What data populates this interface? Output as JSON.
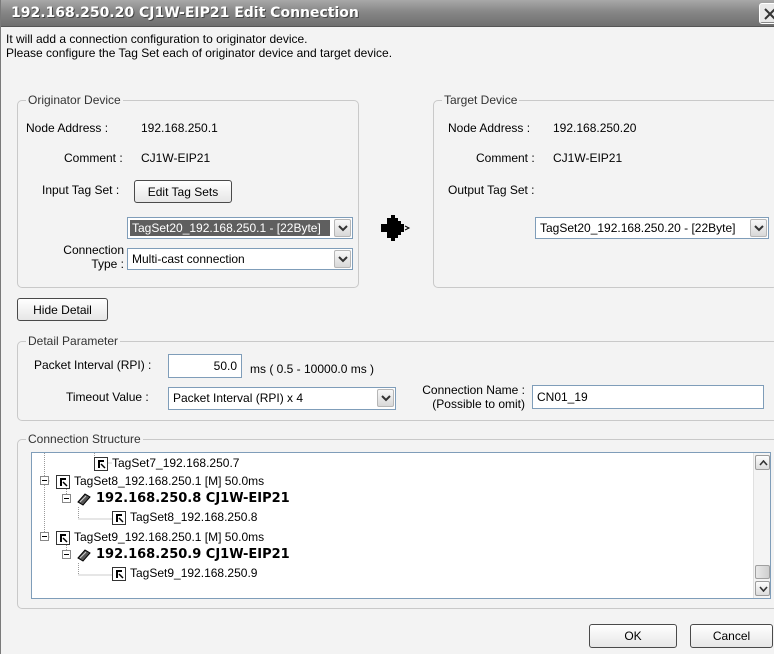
{
  "window": {
    "title": "192.168.250.20 CJ1W-EIP21 Edit Connection",
    "close_icon": "close-icon"
  },
  "intro": {
    "line1": "It will add a connection configuration to originator device.",
    "line2": "Please configure the Tag Set each of originator device and target device."
  },
  "originator": {
    "legend": "Originator Device",
    "node_address_label": "Node Address :",
    "node_address": "192.168.250.1",
    "comment_label": "Comment :",
    "comment": "CJ1W-EIP21",
    "input_tag_set_label": "Input Tag Set :",
    "edit_tag_sets_label": "Edit Tag Sets",
    "input_tag_set_value": "TagSet20_192.168.250.1 - [22Byte]",
    "connection_type_label_line1": "Connection",
    "connection_type_label_line2": "Type :",
    "connection_type_value": "Multi-cast connection"
  },
  "connector_icon": "connection-arrow-icon",
  "target": {
    "legend": "Target Device",
    "node_address_label": "Node Address :",
    "node_address": "192.168.250.20",
    "comment_label": "Comment :",
    "comment": "CJ1W-EIP21",
    "output_tag_set_label": "Output Tag Set :",
    "output_tag_set_value": "TagSet20_192.168.250.20 - [22Byte]"
  },
  "hide_detail_label": "Hide Detail",
  "detail": {
    "legend": "Detail Parameter",
    "rpi_label": "Packet Interval (RPI) :",
    "rpi_value": "50.0",
    "rpi_range": "ms ( 0.5 - 10000.0 ms )",
    "timeout_label": "Timeout Value :",
    "timeout_value": "Packet Interval (RPI) x 4",
    "conn_name_label_line1": "Connection Name :",
    "conn_name_label_line2": "(Possible to omit)",
    "conn_name_value": "CN01_19"
  },
  "structure": {
    "legend": "Connection Structure",
    "rows": [
      "TagSet7_192.168.250.7",
      "TagSet8_192.168.250.1 [M] 50.0ms",
      "192.168.250.8 CJ1W-EIP21",
      "TagSet8_192.168.250.8",
      "TagSet9_192.168.250.1 [M] 50.0ms",
      "192.168.250.9 CJ1W-EIP21",
      "TagSet9_192.168.250.9"
    ]
  },
  "buttons": {
    "ok": "OK",
    "cancel": "Cancel"
  }
}
